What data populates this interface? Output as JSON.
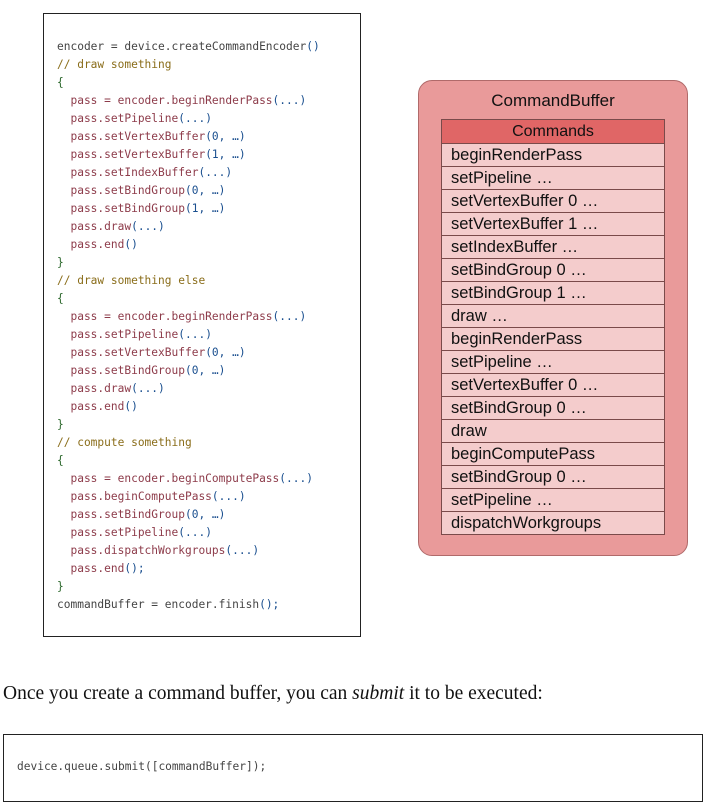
{
  "code_block": {
    "lines": [
      {
        "segments": [
          {
            "t": "encoder = device.createCommandEncoder",
            "c": ""
          },
          {
            "t": "()",
            "c": "pun"
          }
        ]
      },
      {
        "segments": [
          {
            "t": "// draw something",
            "c": "comment"
          }
        ]
      },
      {
        "segments": [
          {
            "t": "{",
            "c": "brace"
          }
        ]
      },
      {
        "segments": [
          {
            "t": "  pass = encoder.beginRenderPass",
            "c": "kw"
          },
          {
            "t": "(...)",
            "c": "pun"
          }
        ]
      },
      {
        "segments": [
          {
            "t": "  pass.setPipeline",
            "c": "kw"
          },
          {
            "t": "(...)",
            "c": "pun"
          }
        ]
      },
      {
        "segments": [
          {
            "t": "  pass.setVertexBuffer",
            "c": "kw"
          },
          {
            "t": "(0, …)",
            "c": "pun"
          }
        ]
      },
      {
        "segments": [
          {
            "t": "  pass.setVertexBuffer",
            "c": "kw"
          },
          {
            "t": "(1, …)",
            "c": "pun"
          }
        ]
      },
      {
        "segments": [
          {
            "t": "  pass.setIndexBuffer",
            "c": "kw"
          },
          {
            "t": "(...)",
            "c": "pun"
          }
        ]
      },
      {
        "segments": [
          {
            "t": "  pass.setBindGroup",
            "c": "kw"
          },
          {
            "t": "(0, …)",
            "c": "pun"
          }
        ]
      },
      {
        "segments": [
          {
            "t": "  pass.setBindGroup",
            "c": "kw"
          },
          {
            "t": "(1, …)",
            "c": "pun"
          }
        ]
      },
      {
        "segments": [
          {
            "t": "  pass.draw",
            "c": "kw"
          },
          {
            "t": "(...)",
            "c": "pun"
          }
        ]
      },
      {
        "segments": [
          {
            "t": "  pass.end",
            "c": "kw"
          },
          {
            "t": "()",
            "c": "pun"
          }
        ]
      },
      {
        "segments": [
          {
            "t": "}",
            "c": "brace"
          }
        ]
      },
      {
        "segments": [
          {
            "t": "// draw something else",
            "c": "comment"
          }
        ]
      },
      {
        "segments": [
          {
            "t": "{",
            "c": "brace"
          }
        ]
      },
      {
        "segments": [
          {
            "t": "  pass = encoder.beginRenderPass",
            "c": "kw"
          },
          {
            "t": "(...)",
            "c": "pun"
          }
        ]
      },
      {
        "segments": [
          {
            "t": "  pass.setPipeline",
            "c": "kw"
          },
          {
            "t": "(...)",
            "c": "pun"
          }
        ]
      },
      {
        "segments": [
          {
            "t": "  pass.setVertexBuffer",
            "c": "kw"
          },
          {
            "t": "(0, …)",
            "c": "pun"
          }
        ]
      },
      {
        "segments": [
          {
            "t": "  pass.setBindGroup",
            "c": "kw"
          },
          {
            "t": "(0, …)",
            "c": "pun"
          }
        ]
      },
      {
        "segments": [
          {
            "t": "  pass.draw",
            "c": "kw"
          },
          {
            "t": "(...)",
            "c": "pun"
          }
        ]
      },
      {
        "segments": [
          {
            "t": "  pass.end",
            "c": "kw"
          },
          {
            "t": "()",
            "c": "pun"
          }
        ]
      },
      {
        "segments": [
          {
            "t": "}",
            "c": "brace"
          }
        ]
      },
      {
        "segments": [
          {
            "t": "// compute something",
            "c": "comment"
          }
        ]
      },
      {
        "segments": [
          {
            "t": "{",
            "c": "brace"
          }
        ]
      },
      {
        "segments": [
          {
            "t": "  pass = encoder.beginComputePass",
            "c": "kw"
          },
          {
            "t": "(...)",
            "c": "pun"
          }
        ]
      },
      {
        "segments": [
          {
            "t": "  pass.beginComputePass",
            "c": "kw"
          },
          {
            "t": "(...)",
            "c": "pun"
          }
        ]
      },
      {
        "segments": [
          {
            "t": "  pass.setBindGroup",
            "c": "kw"
          },
          {
            "t": "(0, …)",
            "c": "pun"
          }
        ]
      },
      {
        "segments": [
          {
            "t": "  pass.setPipeline",
            "c": "kw"
          },
          {
            "t": "(...)",
            "c": "pun"
          }
        ]
      },
      {
        "segments": [
          {
            "t": "  pass.dispatchWorkgroups",
            "c": "kw"
          },
          {
            "t": "(...)",
            "c": "pun"
          }
        ]
      },
      {
        "segments": [
          {
            "t": "  pass.end",
            "c": "kw"
          },
          {
            "t": "();",
            "c": "pun"
          }
        ]
      },
      {
        "segments": [
          {
            "t": "}",
            "c": "brace"
          }
        ]
      },
      {
        "segments": [
          {
            "t": "commandBuffer = encoder.finish",
            "c": ""
          },
          {
            "t": "();",
            "c": "pun"
          }
        ]
      }
    ]
  },
  "command_buffer": {
    "title": "CommandBuffer",
    "header": "Commands",
    "commands": [
      "beginRenderPass",
      "setPipeline …",
      "setVertexBuffer 0 …",
      "setVertexBuffer 1 …",
      "setIndexBuffer …",
      "setBindGroup 0 …",
      "setBindGroup 1 …",
      "draw …",
      "beginRenderPass",
      "setPipeline …",
      "setVertexBuffer 0 …",
      "setBindGroup 0 …",
      "draw",
      "beginComputePass",
      "setBindGroup 0 …",
      "setPipeline …",
      "dispatchWorkgroups"
    ]
  },
  "prose": {
    "before": "Once you create a command buffer, you can ",
    "emphasis": "submit",
    "after": " it to be executed:"
  },
  "submit_code": "device.queue.submit([commandBuffer]);",
  "colors": {
    "panel": "#e99a9a",
    "header": "#e06666",
    "row": "#f4cccc"
  }
}
